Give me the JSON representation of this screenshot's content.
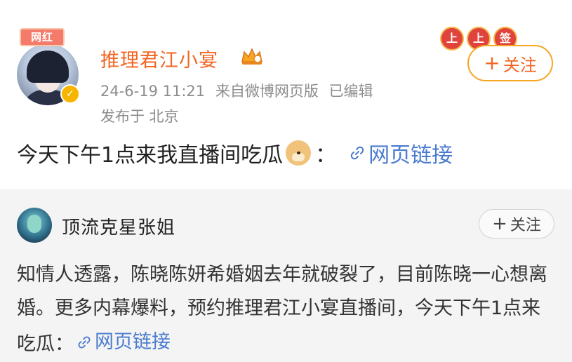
{
  "post": {
    "avatar_badge": "网红",
    "username": "推理君江小宴",
    "date": "24-6-19 11:21",
    "source": "来自微博网页版",
    "edited": "已编辑",
    "location": "发布于 北京",
    "follow_label": "关注",
    "deco_chars": [
      "上",
      "上",
      "签"
    ],
    "content_text": "今天下午1点来我直播间吃瓜",
    "content_colon": "：",
    "link_label": "网页链接"
  },
  "repost": {
    "username": "顶流克星张姐",
    "follow_label": "关注",
    "text": "知情人透露，陈晓陈妍希婚姻去年就破裂了，目前陈晓一心想离婚。更多内幕爆料，预约推理君江小宴直播间，今天下午1点来吃瓜：",
    "link_label": "网页链接"
  },
  "colors": {
    "username": "#f26522",
    "link": "#4a7bcf",
    "follow_border": "#f5a623",
    "repost_bg": "#f4f4f4"
  },
  "icons": [
    "crown-icon",
    "verified-icon",
    "doge-emoji-icon",
    "link-icon",
    "plus-icon"
  ]
}
